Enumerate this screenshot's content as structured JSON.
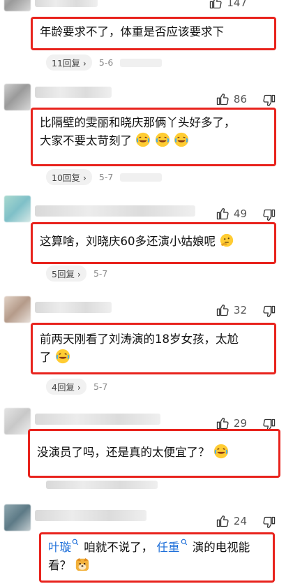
{
  "comments": [
    {
      "likes": "147",
      "text": "年龄要求不了，体重是否应该要求下",
      "replies": "11回复",
      "date": "5-6"
    },
    {
      "likes": "86",
      "text_a": "比隔壁的雯丽和晓庆那俩丫头好多了，",
      "text_b": "大家不要太苛刻了",
      "replies": "10回复",
      "date": "5-7"
    },
    {
      "likes": "49",
      "text": "这算啥，刘晓庆60多还演小姑娘呢",
      "replies": "5回复",
      "date": "5-7"
    },
    {
      "likes": "32",
      "text_a": "前两天刚看了刘涛演的18岁女孩，太尬",
      "text_b": "了",
      "replies": "4回复",
      "date": "5-7"
    },
    {
      "likes": "29",
      "text": "没演员了吗，还是真的太便宜了？",
      "replies": "",
      "date": ""
    },
    {
      "likes": "24",
      "kw1": "叶璇",
      "mid": "咱就不说了，",
      "kw2": "任重",
      "tail": "演的电视能",
      "tail2": "看？"
    }
  ],
  "icons": [
    "thumbs-up-icon",
    "thumbs-down-icon",
    "laughing-crying-emoji",
    "thinking-emoji",
    "doge-emoji",
    "search-icon"
  ]
}
